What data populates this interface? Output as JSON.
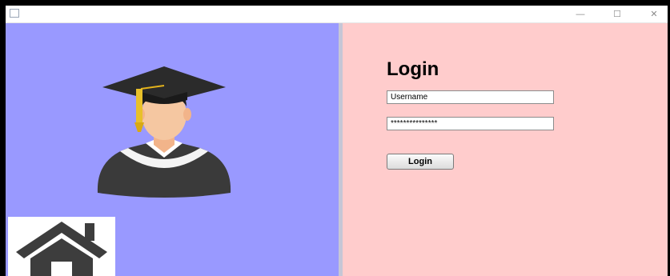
{
  "window": {
    "controls": {
      "minimize": "—",
      "maximize": "☐",
      "close": "✕"
    }
  },
  "colors": {
    "left_panel": "#9999ff",
    "right_panel": "#ffcccc",
    "divider": "#c6c6d6"
  },
  "images": {
    "graduate": "graduate-avatar-icon",
    "home": "home-icon"
  },
  "login": {
    "title": "Login",
    "username_value": "Username",
    "password_value": "***************",
    "button_label": "Login"
  }
}
